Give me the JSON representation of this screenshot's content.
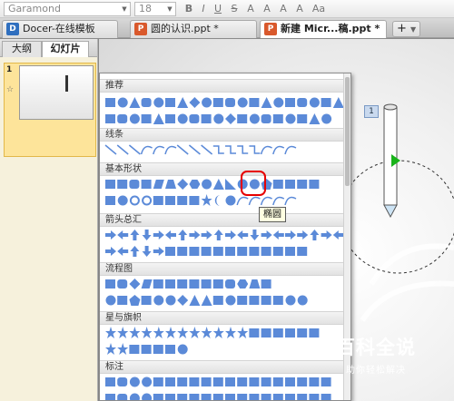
{
  "toolbar": {
    "font_name": "Garamond",
    "font_size": "18",
    "buttons": [
      "B",
      "I",
      "U",
      "S",
      "A",
      "A",
      "A",
      "A",
      "Aa"
    ]
  },
  "tabs": [
    {
      "label": "Docer-在线模板",
      "icon": "docer-icon",
      "icon_text": "D",
      "icon_color": "#2f6fbf",
      "active": false
    },
    {
      "label": "圆的认识.ppt *",
      "icon": "ppt-icon",
      "icon_text": "P",
      "icon_color": "#d9592c",
      "active": false
    },
    {
      "label": "新建 Micr...稿.ppt *",
      "icon": "ppt-icon",
      "icon_text": "P",
      "icon_color": "#d9592c",
      "active": true
    }
  ],
  "add_tab_label": "+",
  "panel": {
    "tabs": [
      "大纲",
      "幻灯片"
    ],
    "active_tab": "幻灯片",
    "slide_number": "1",
    "slide_star": "☆"
  },
  "slide": {
    "badge": "1"
  },
  "shapes_menu": {
    "categories": [
      "推荐",
      "线条",
      "基本形状",
      "箭头总汇",
      "流程图",
      "星与旗帜",
      "标注"
    ],
    "selected_shape": "oval",
    "tooltip": "椭圆"
  },
  "watermark": {
    "main": "百科全说",
    "sub": "助你轻松解决"
  },
  "colors": {
    "shape_fill": "#5b8ad8",
    "highlight": "#e60000",
    "accent_green": "#19b31a"
  }
}
